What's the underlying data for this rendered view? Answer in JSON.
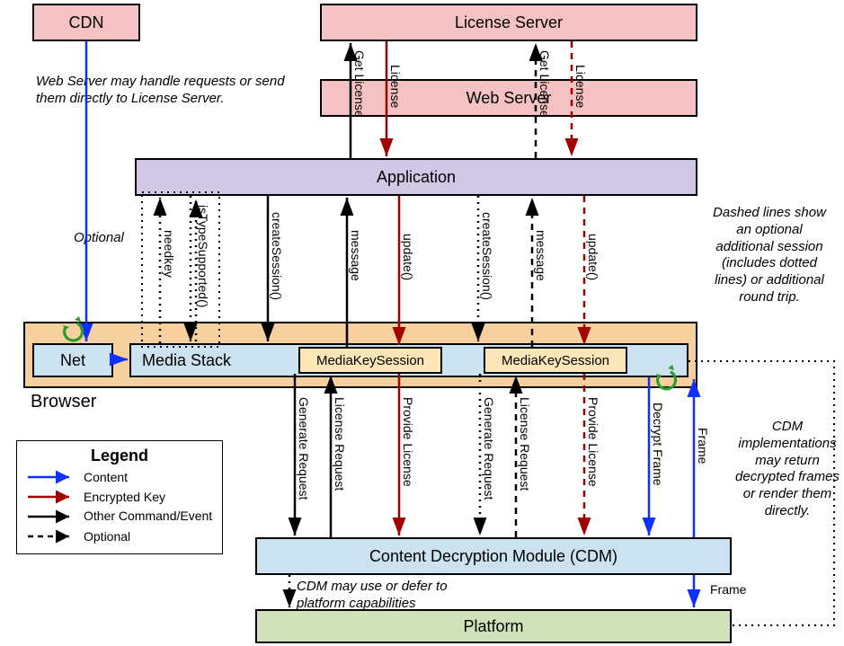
{
  "domain": "Diagram",
  "nodes": {
    "cdn": "CDN",
    "license_server": "License Server",
    "web_server": "Web Server",
    "application": "Application",
    "browser": "Browser",
    "net": "Net",
    "media_stack": "Media Stack",
    "mks1": "MediaKeySession",
    "mks2": "MediaKeySession",
    "cdm": "Content Decryption Module (CDM)",
    "platform": "Platform"
  },
  "edge_labels": {
    "get_license_1": "Get License",
    "license_1": "License",
    "get_license_2": "Get License",
    "license_2": "License",
    "needkey": "needkey",
    "isTypeSupported": "isTypeSupported()",
    "createSession_1": "createSession()",
    "message_1": "message",
    "update_1": "update()",
    "createSession_2": "createSession()",
    "message_2": "message",
    "update_2": "update()",
    "generate_request_1": "Generate Request",
    "license_request_1": "License Request",
    "provide_license_1": "Provide License",
    "generate_request_2": "Generate Request",
    "license_request_2": "License Request",
    "provide_license_2": "Provide License",
    "decrypt_frame": "Decrypt Frame",
    "frame_up": "Frame",
    "frame_down": "Frame"
  },
  "notes": {
    "web_server_note": "Web Server may handle requests or send them directly to License Server.",
    "optional": "Optional",
    "dashed_note": "Dashed lines show an optional additional session (includes dotted lines) or additional round trip.",
    "cdm_impl_note": "CDM implementations may return decrypted frames or render them directly.",
    "cdm_defer_note": "CDM may use or defer to platform capabilities"
  },
  "legend": {
    "title": "Legend",
    "content": "Content",
    "encrypted_key": "Encrypted Key",
    "other": "Other Command/Event",
    "optional": "Optional"
  }
}
